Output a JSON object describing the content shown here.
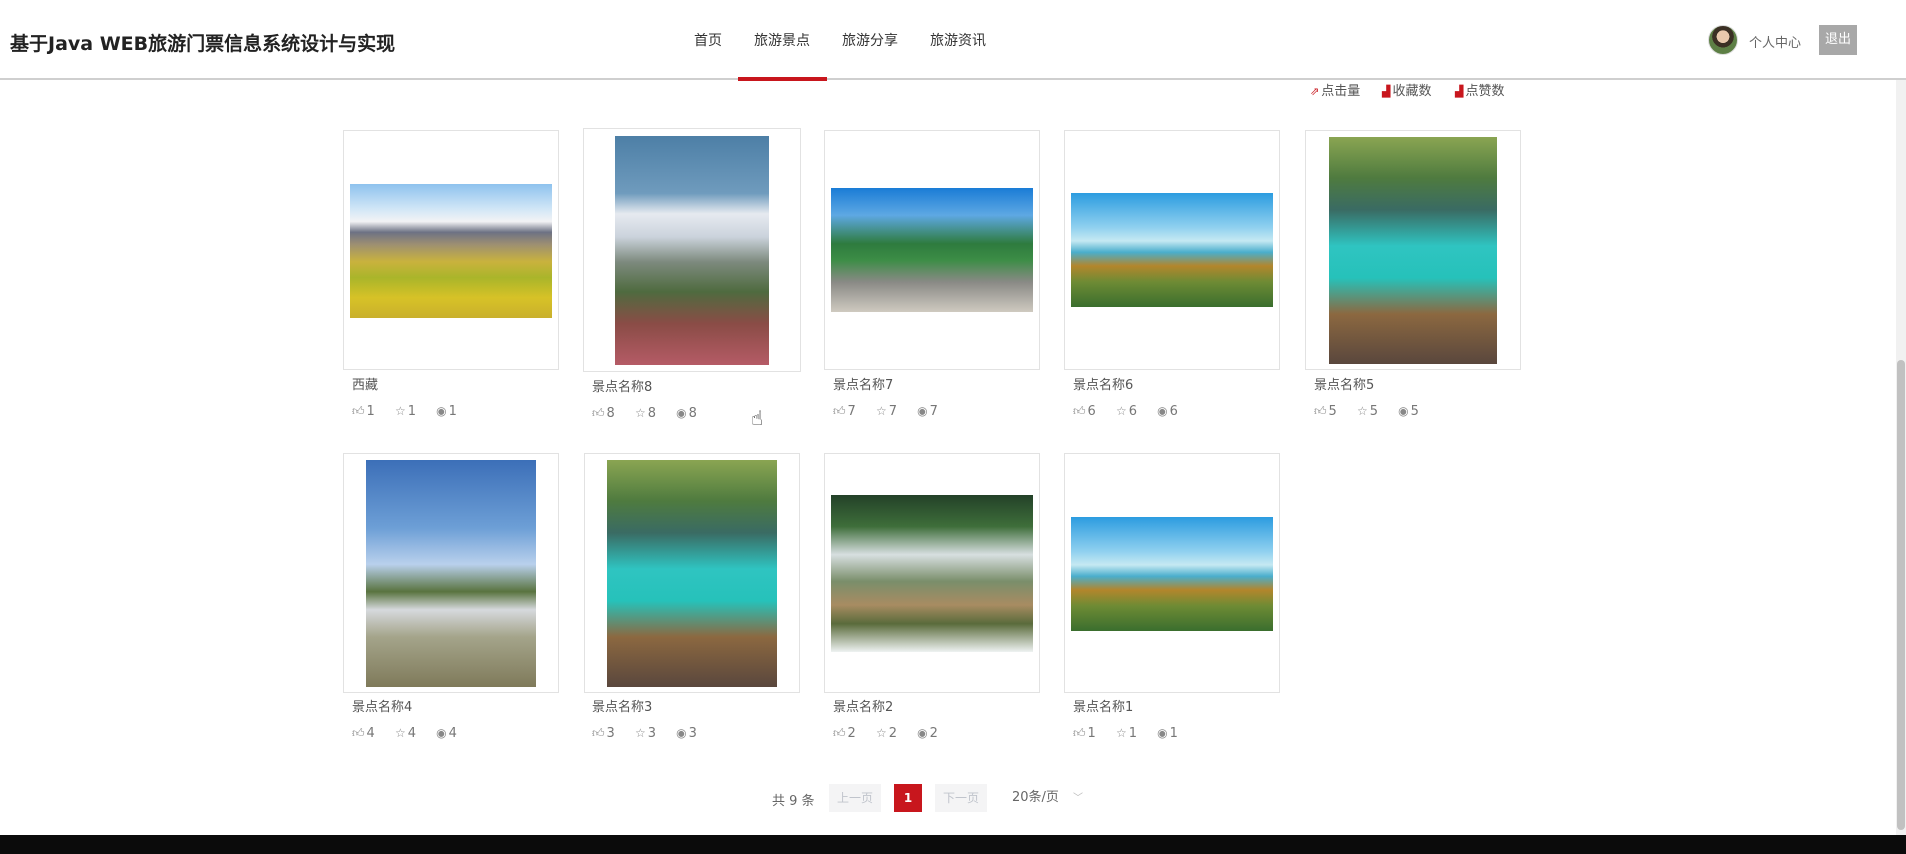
{
  "header": {
    "site_title": "基于Java WEB旅游门票信息系统设计与实现",
    "nav": [
      "首页",
      "旅游景点",
      "旅游分享",
      "旅游资讯"
    ],
    "active_nav": "旅游景点",
    "user_center": "个人中心",
    "logout": "退出"
  },
  "sort": {
    "clicks": "点击量",
    "favorites": "收藏数",
    "likes": "点赞数"
  },
  "spots": [
    {
      "name": "西藏",
      "likes": "1",
      "stars": "1",
      "views": "1",
      "image": "plateau-meadow-snow-mountains"
    },
    {
      "name": "景点名称8",
      "likes": "8",
      "stars": "8",
      "views": "8",
      "image": "pagoda-above-clouds"
    },
    {
      "name": "景点名称7",
      "likes": "7",
      "stars": "7",
      "views": "7",
      "image": "green-roof-pavilion"
    },
    {
      "name": "景点名称6",
      "likes": "6",
      "stars": "6",
      "views": "6",
      "image": "mountain-sea-of-clouds"
    },
    {
      "name": "景点名称5",
      "likes": "5",
      "stars": "5",
      "views": "5",
      "image": "turquoise-lake-with-girl"
    },
    {
      "name": "景点名称4",
      "likes": "4",
      "stars": "4",
      "views": "4",
      "image": "marble-boat-lake"
    },
    {
      "name": "景点名称3",
      "likes": "3",
      "stars": "3",
      "views": "3",
      "image": "turquoise-lake-with-girl"
    },
    {
      "name": "景点名称2",
      "likes": "2",
      "stars": "2",
      "views": "2",
      "image": "forest-waterfall"
    },
    {
      "name": "景点名称1",
      "likes": "1",
      "stars": "1",
      "views": "1",
      "image": "mountain-sea-of-clouds"
    }
  ],
  "pagination": {
    "total": "共 9 条",
    "prev": "上一页",
    "current": "1",
    "next": "下一页",
    "page_size": "20条/页"
  },
  "colors": {
    "accent": "#c8161d",
    "logout_bg": "#a8a8a8"
  }
}
